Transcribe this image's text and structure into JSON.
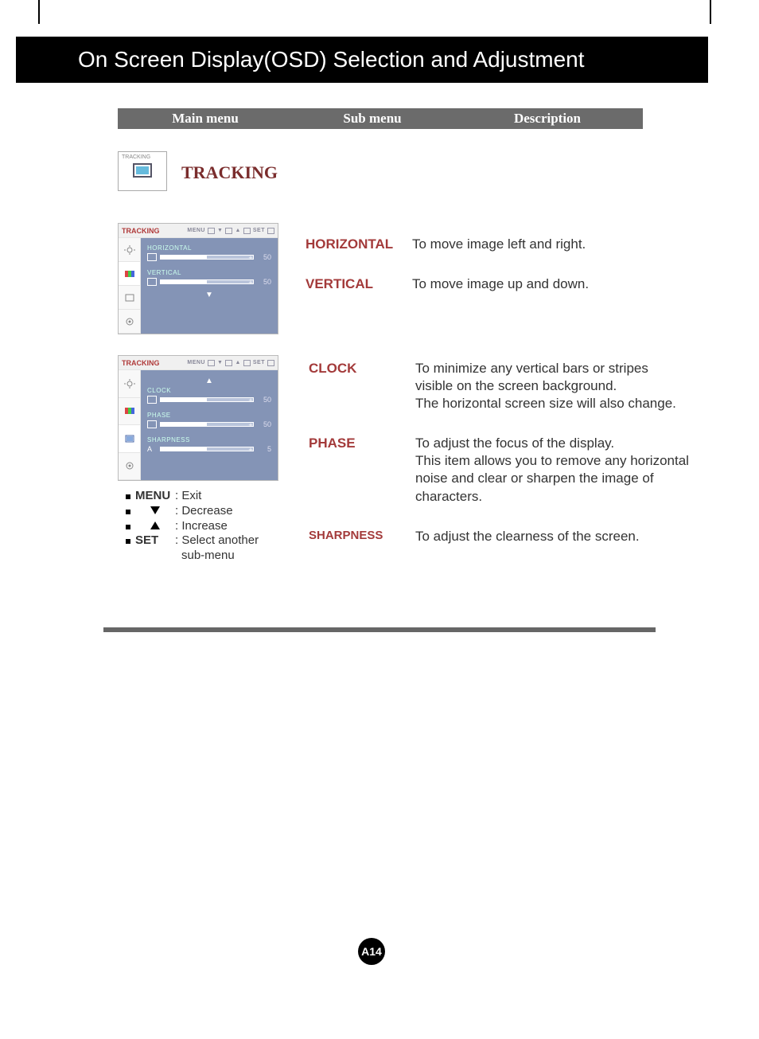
{
  "page_title": "On Screen Display(OSD) Selection and Adjustment",
  "page_number": "A14",
  "table_head": {
    "main": "Main menu",
    "sub": "Sub menu",
    "desc": "Description"
  },
  "icon_box_label": "TRACKING",
  "section_title": "TRACKING",
  "osd_panels": {
    "a": {
      "title": "TRACKING",
      "top_menu": "MENU",
      "top_set": "SET",
      "rows": [
        {
          "label": "HORIZONTAL",
          "value": "50"
        },
        {
          "label": "VERTICAL",
          "value": "50"
        }
      ]
    },
    "b": {
      "title": "TRACKING",
      "top_menu": "MENU",
      "top_set": "SET",
      "rows": [
        {
          "label": "CLOCK",
          "value": "50"
        },
        {
          "label": "PHASE",
          "value": "50"
        },
        {
          "label": "SHARPNESS",
          "value": "5"
        }
      ]
    }
  },
  "legend": {
    "menu_key": "MENU",
    "menu_desc": ": Exit",
    "dec_desc": ": Decrease",
    "inc_desc": ": Increase",
    "set_key": "SET",
    "set_desc": ": Select another",
    "set_desc2": "sub-menu"
  },
  "defs": [
    {
      "key": "HORIZONTAL",
      "desc": "To move image left and right."
    },
    {
      "key": "VERTICAL",
      "desc": "To move image up and down."
    }
  ],
  "defs_b": [
    {
      "key": "CLOCK",
      "desc": "To minimize any vertical bars or stripes visible on the screen background.\nThe horizontal screen size will also change."
    },
    {
      "key": "PHASE",
      "desc": "To adjust the focus of the display.\nThis item allows you to remove any horizontal noise and clear or sharpen the image of characters."
    },
    {
      "key": "SHARPNESS",
      "desc": "To adjust the clearness of the screen."
    }
  ]
}
